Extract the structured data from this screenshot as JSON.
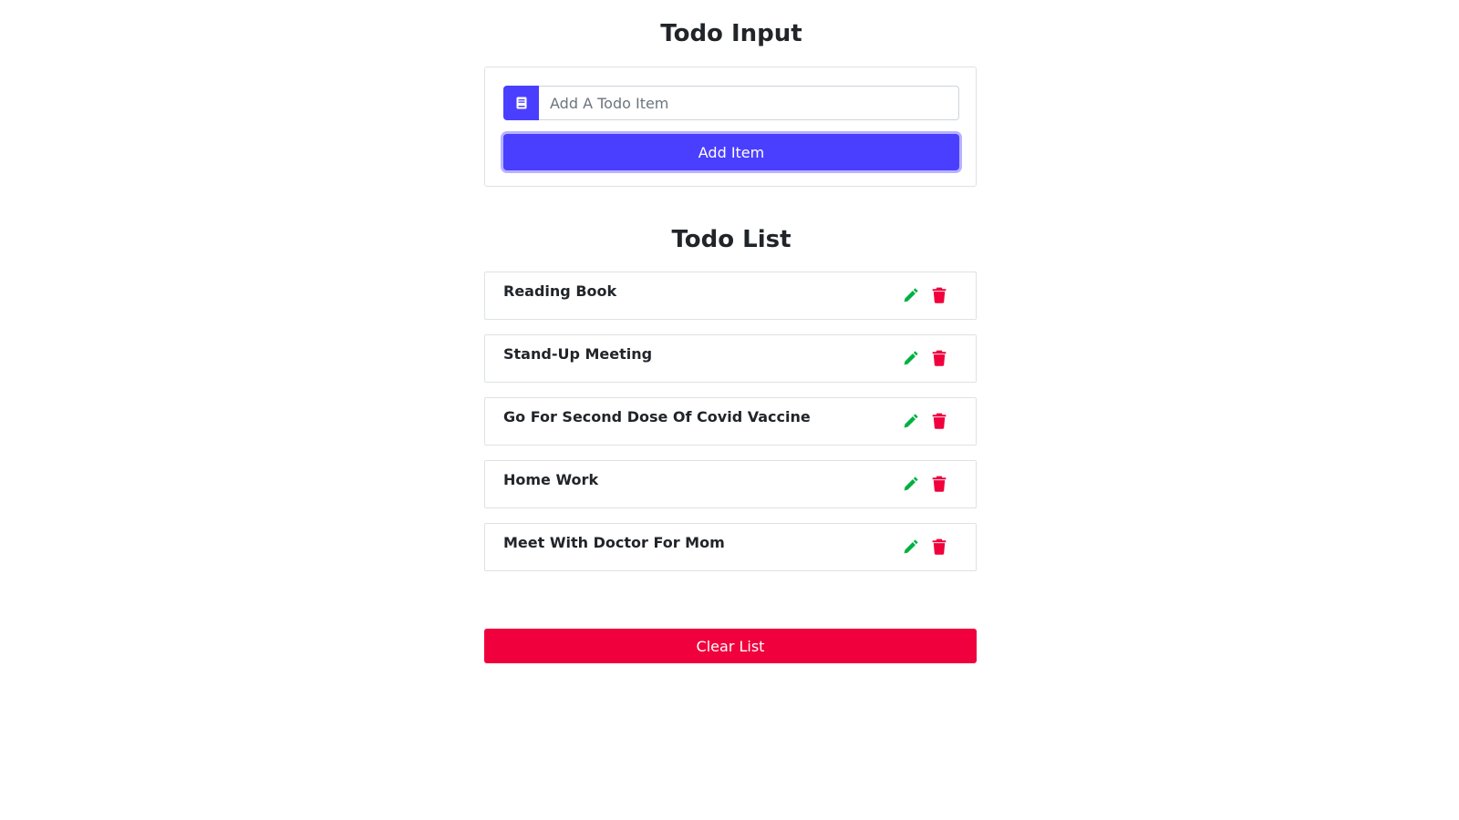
{
  "input_section": {
    "title": "Todo Input",
    "placeholder": "Add A Todo Item",
    "value": "",
    "prefix_icon": "book-icon",
    "add_label": "Add Item"
  },
  "list_section": {
    "title": "Todo List",
    "items": [
      {
        "label": "Reading Book"
      },
      {
        "label": "Stand-Up Meeting"
      },
      {
        "label": "Go For Second Dose Of Covid Vaccine"
      },
      {
        "label": "Home Work"
      },
      {
        "label": "Meet With Doctor For Mom"
      }
    ],
    "edit_icon": "pencil-icon",
    "delete_icon": "trash-icon",
    "clear_label": "Clear List"
  },
  "colors": {
    "primary": "#4a3fff",
    "danger": "#f0003c",
    "edit": "#00b140",
    "delete": "#f0003c"
  }
}
